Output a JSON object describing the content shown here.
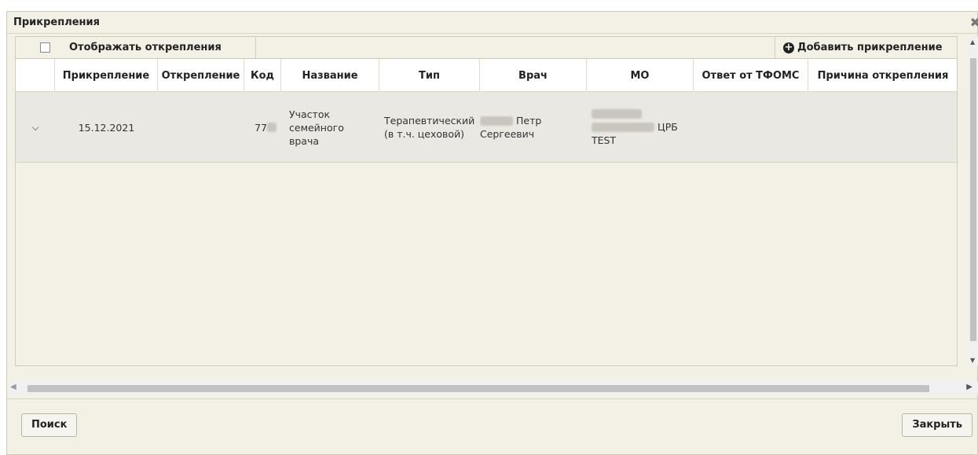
{
  "dialog": {
    "title": "Прикрепления"
  },
  "toolbar": {
    "show_detachments_label": "Отображать открепления",
    "add_attachment_label": "Добавить прикрепление"
  },
  "table": {
    "columns": [
      "Прикрепление",
      "Открепление",
      "Код",
      "Название",
      "Тип",
      "Врач",
      "МО",
      "Ответ от ТФОМС",
      "Причина открепления"
    ],
    "rows": [
      {
        "attached": "15.12.2021",
        "detached": "",
        "code": "77",
        "name": "Участок семейного врача",
        "type_line1": "Терапевтический",
        "type_line2": "(в т.ч. цеховой)",
        "doctor_line1": "Петр",
        "doctor_line2": "Сергеевич",
        "mo_line2": "ЦРБ",
        "mo_line3": "TEST",
        "tfoms_response": "",
        "detach_reason": ""
      }
    ]
  },
  "footer": {
    "search_label": "Поиск",
    "close_label": "Закрыть"
  },
  "icons": {
    "close": "close-icon",
    "add": "plus-circle-icon",
    "expand": "chevron-down-icon"
  }
}
